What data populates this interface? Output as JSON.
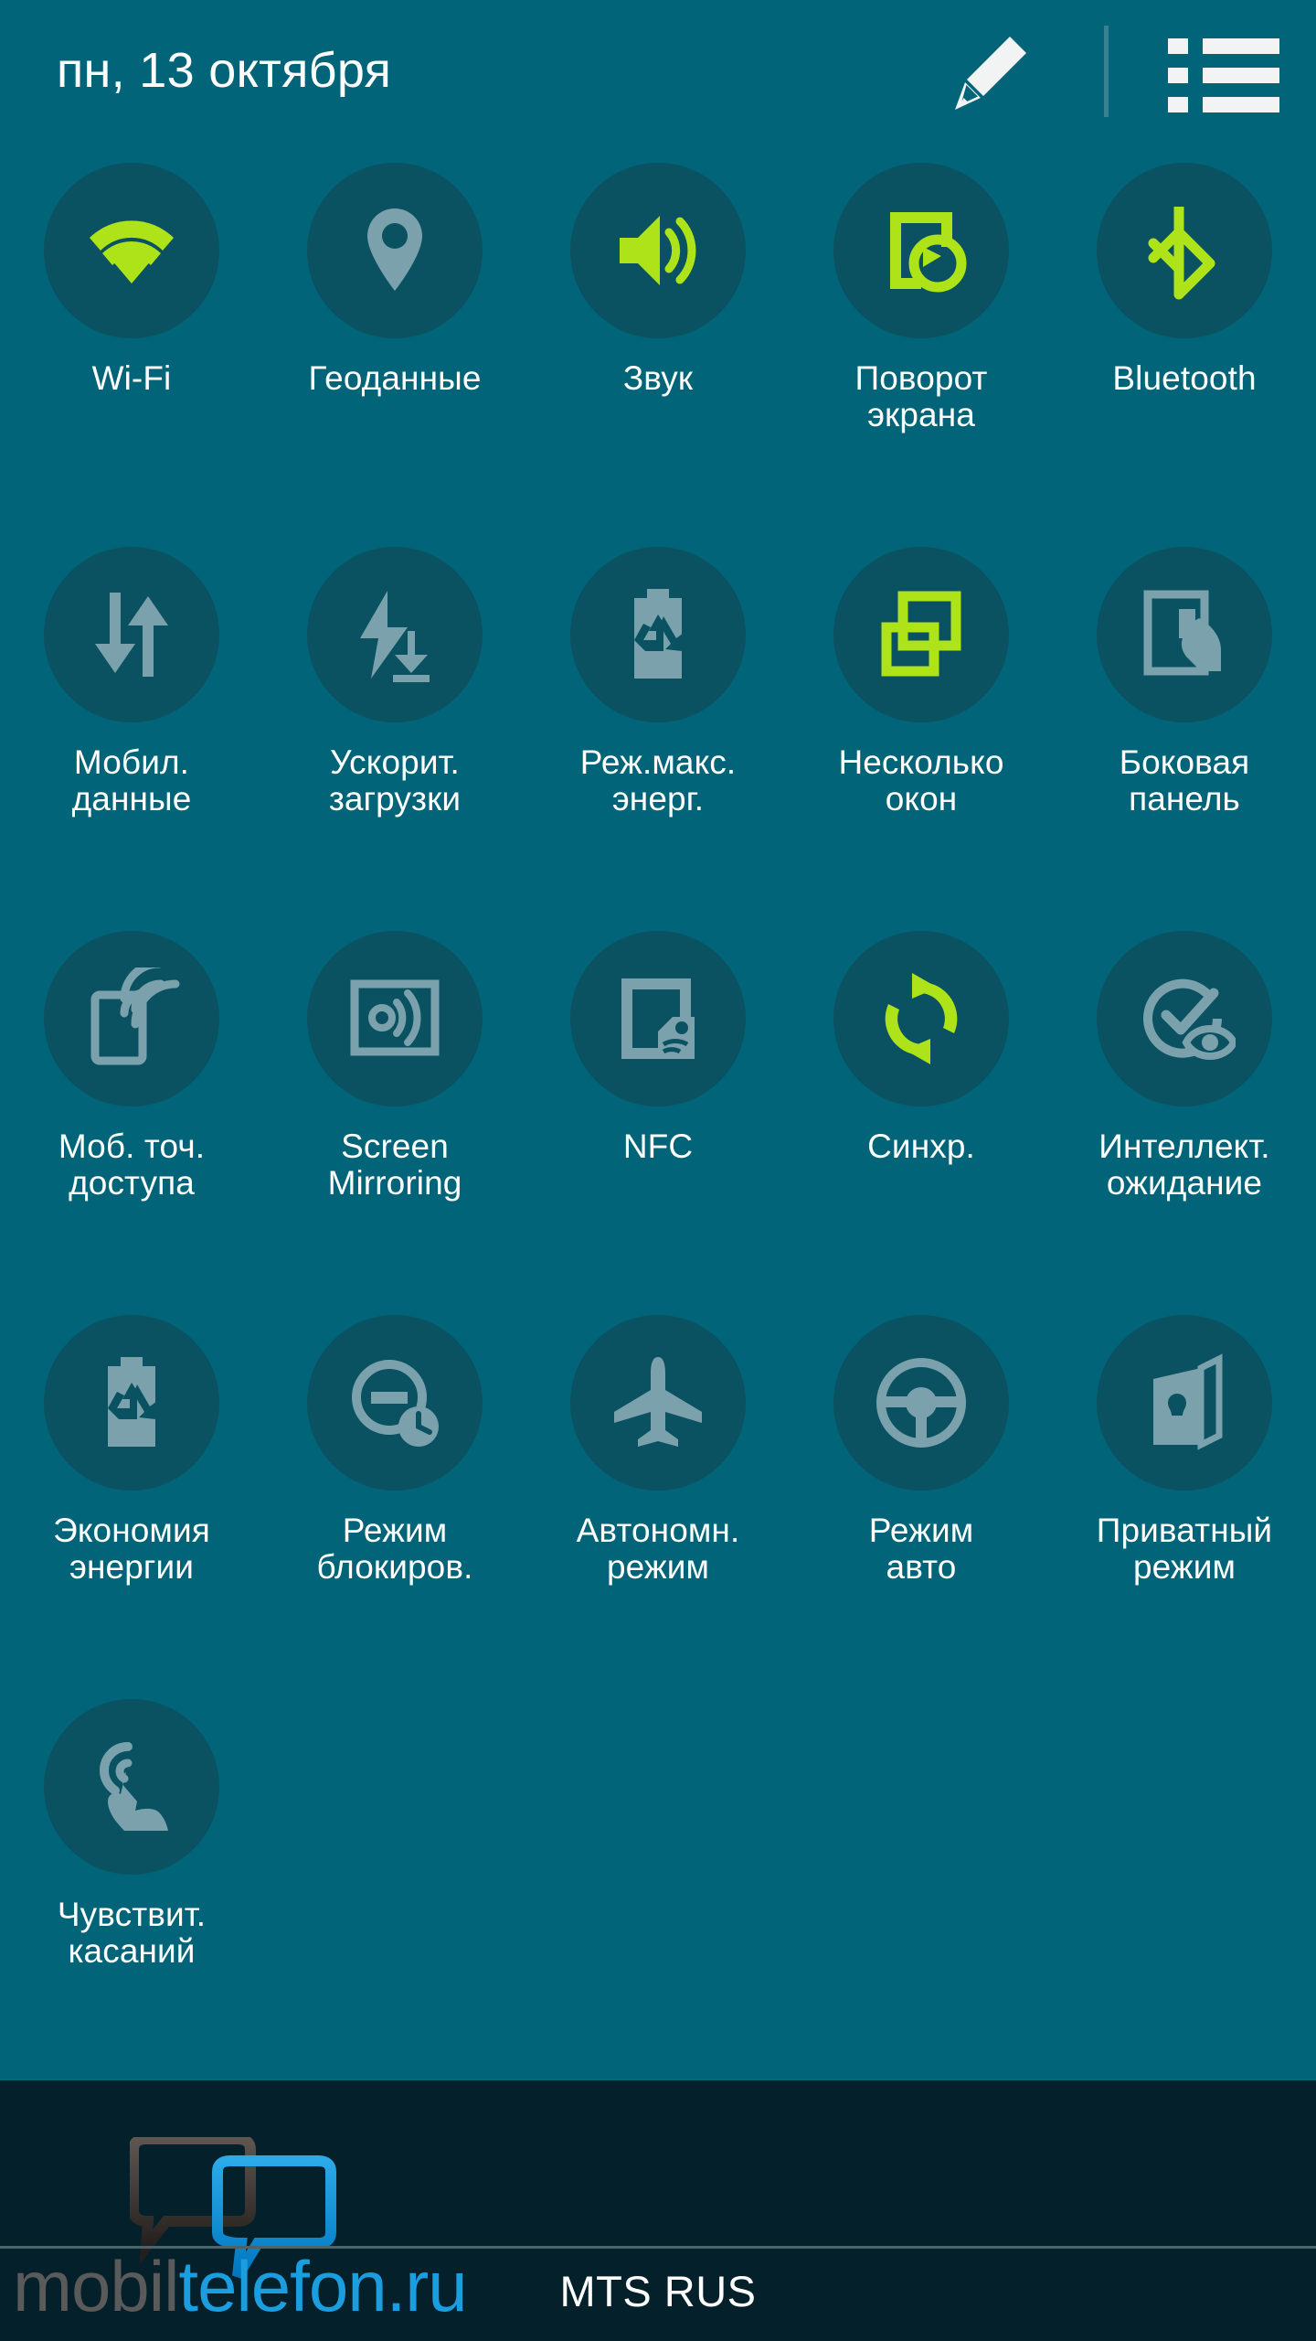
{
  "header": {
    "date": "пн, 13 октября",
    "edit_icon": "pencil-icon",
    "list_icon": "list-icon"
  },
  "colors": {
    "panel_background": "#016478",
    "tile_circle": "#0a5261",
    "accent_on": "#aee319",
    "icon_off": "#7ba2ac",
    "label_text": "#ffffff",
    "bottom_strip": "#04212b",
    "watermark_blue": "#1b9ee0",
    "watermark_grey": "#5a5a5a"
  },
  "tiles": [
    {
      "id": "wifi",
      "label": "Wi-Fi",
      "icon": "wifi-icon",
      "state": "on"
    },
    {
      "id": "location",
      "label": "Геоданные",
      "icon": "location-pin-icon",
      "state": "off"
    },
    {
      "id": "sound",
      "label": "Звук",
      "icon": "speaker-icon",
      "state": "on"
    },
    {
      "id": "screen-rotation",
      "label": "Поворот\nэкрана",
      "icon": "screen-rotation-icon",
      "state": "on"
    },
    {
      "id": "bluetooth",
      "label": "Bluetooth",
      "icon": "bluetooth-icon",
      "state": "on"
    },
    {
      "id": "mobile-data",
      "label": "Мобил.\nданные",
      "icon": "data-arrows-icon",
      "state": "off"
    },
    {
      "id": "download-booster",
      "label": "Ускорит.\nзагрузки",
      "icon": "bolt-download-icon",
      "state": "off"
    },
    {
      "id": "ultra-power-save",
      "label": "Реж.макс.\nэнерг.",
      "icon": "battery-recycle-icon",
      "state": "off"
    },
    {
      "id": "multi-window",
      "label": "Несколько\nокон",
      "icon": "multi-window-icon",
      "state": "on"
    },
    {
      "id": "side-panel",
      "label": "Боковая\nпанель",
      "icon": "side-panel-hand-icon",
      "state": "off"
    },
    {
      "id": "mobile-hotspot",
      "label": "Моб. точ.\nдоступа",
      "icon": "hotspot-icon",
      "state": "off"
    },
    {
      "id": "screen-mirroring",
      "label": "Screen\nMirroring",
      "icon": "screen-mirroring-icon",
      "state": "off"
    },
    {
      "id": "nfc",
      "label": "NFC",
      "icon": "nfc-icon",
      "state": "off"
    },
    {
      "id": "sync",
      "label": "Синхр.",
      "icon": "sync-icon",
      "state": "on"
    },
    {
      "id": "smart-stay",
      "label": "Интеллект.\nожидание",
      "icon": "smart-stay-eye-icon",
      "state": "off"
    },
    {
      "id": "power-saving",
      "label": "Экономия\nэнергии",
      "icon": "battery-recycle-icon",
      "state": "off"
    },
    {
      "id": "blocking-mode",
      "label": "Режим\nблокиров.",
      "icon": "blocking-clock-icon",
      "state": "off"
    },
    {
      "id": "airplane-mode",
      "label": "Автономн.\nрежим",
      "icon": "airplane-icon",
      "state": "off"
    },
    {
      "id": "car-mode",
      "label": "Режим\nавто",
      "icon": "steering-wheel-icon",
      "state": "off"
    },
    {
      "id": "private-mode",
      "label": "Приватный\nрежим",
      "icon": "private-lock-icon",
      "state": "off"
    },
    {
      "id": "touch-sensitivity",
      "label": "Чувствит.\nкасаний",
      "icon": "touch-hand-icon",
      "state": "off"
    }
  ],
  "bottom": {
    "carrier": "MTS RUS",
    "watermark_part1": "mobil",
    "watermark_part2": "telefon",
    "watermark_part3": ".ru"
  }
}
